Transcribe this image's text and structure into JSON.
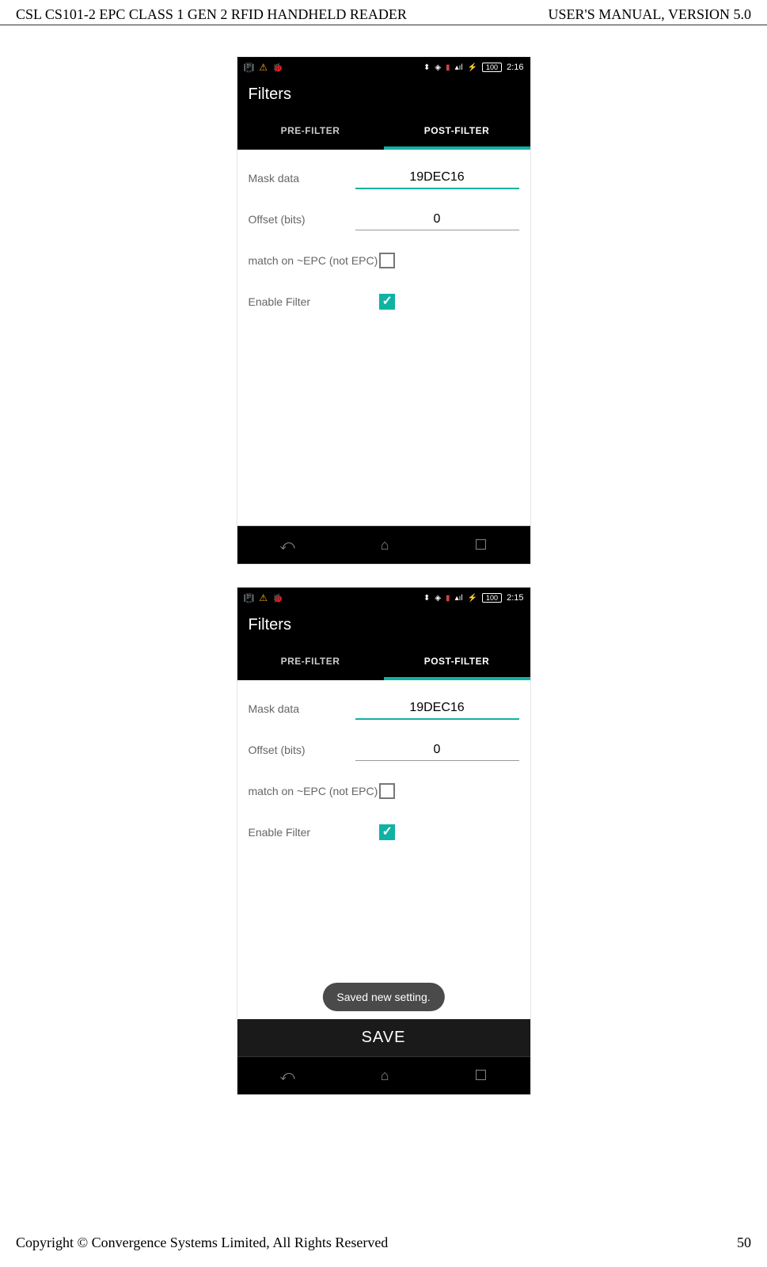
{
  "header": {
    "left": "CSL CS101-2 EPC CLASS 1 GEN 2 RFID HANDHELD READER",
    "right": "USER'S  MANUAL,  VERSION  5.0"
  },
  "footer": {
    "left": "Copyright © Convergence Systems Limited, All Rights Reserved",
    "right": "50"
  },
  "screenshot1": {
    "status_bar": {
      "battery": "100",
      "time": "2:16"
    },
    "title": "Filters",
    "tabs": {
      "pre_filter": "PRE-FILTER",
      "post_filter": "POST-FILTER",
      "active": "post"
    },
    "fields": {
      "mask_data_label": "Mask data",
      "mask_data_value": "19DEC16",
      "offset_label": "Offset (bits)",
      "offset_value": "0",
      "match_label": "match on ~EPC (not EPC)",
      "match_checked": false,
      "enable_label": "Enable Filter",
      "enable_checked": true
    }
  },
  "screenshot2": {
    "status_bar": {
      "battery": "100",
      "time": "2:15"
    },
    "title": "Filters",
    "tabs": {
      "pre_filter": "PRE-FILTER",
      "post_filter": "POST-FILTER",
      "active": "post"
    },
    "fields": {
      "mask_data_label": "Mask data",
      "mask_data_value": "19DEC16",
      "offset_label": "Offset (bits)",
      "offset_value": "0",
      "match_label": "match on ~EPC (not EPC)",
      "match_checked": false,
      "enable_label": "Enable Filter",
      "enable_checked": true
    },
    "toast": "Saved new setting.",
    "save_button": "SAVE"
  }
}
